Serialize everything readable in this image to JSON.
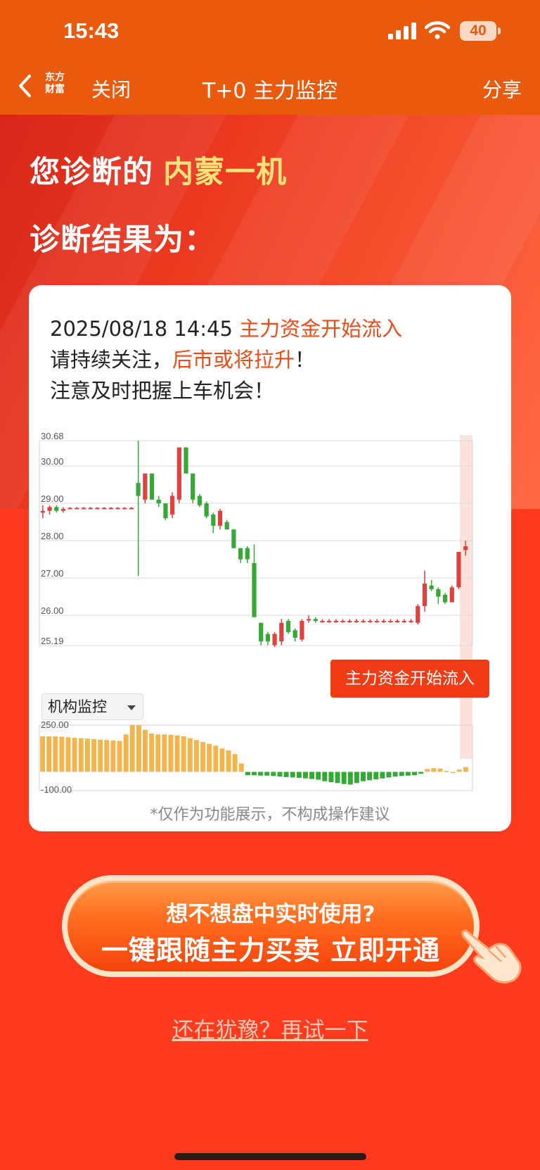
{
  "status_bar": {
    "time": "15:43",
    "battery": "40"
  },
  "nav": {
    "logo_line1": "东方",
    "logo_line2": "财富",
    "close": "关闭",
    "title": "T+0 主力监控",
    "share": "分享"
  },
  "hero": {
    "prefix": "您诊断的",
    "stock_name": "内蒙一机",
    "result_label": "诊断结果为："
  },
  "message": {
    "datetime": "2025/08/18 14:45",
    "signal": "主力资金开始流入",
    "line2_prefix": "请持续关注，",
    "line2_highlight": "后市或将拉升",
    "line2_suffix": "！",
    "line3": "注意及时把握上车机会！"
  },
  "chart_controls": {
    "indicator_select": "机构监控",
    "signal_badge": "主力资金开始流入"
  },
  "disclaimer": "*仅作为功能展示，不构成操作建议",
  "cta": {
    "line1": "想不想盘中实时使用?",
    "line2": "一键跟随主力买卖 立即开通"
  },
  "retry": "还在犹豫？再试一下",
  "colors": {
    "up": "#e04040",
    "down": "#36a836",
    "flow_in": "#f2b54c",
    "flow_out": "#36a836",
    "accent": "#f24a16"
  },
  "chart_data": [
    {
      "type": "candlestick",
      "ytick_labels": [
        "30.68",
        "30.00",
        "29.00",
        "28.00",
        "27.00",
        "26.00",
        "25.19"
      ],
      "ylim": [
        25.19,
        30.68
      ],
      "grid": true,
      "annotation": "主力资金开始流入",
      "series": [
        {
          "o": 28.75,
          "h": 28.95,
          "l": 28.6,
          "c": 28.8
        },
        {
          "o": 28.8,
          "h": 28.95,
          "l": 28.7,
          "c": 28.9
        },
        {
          "o": 28.9,
          "h": 28.95,
          "l": 28.75,
          "c": 28.8
        },
        {
          "o": 28.8,
          "h": 28.9,
          "l": 28.75,
          "c": 28.85
        },
        {
          "o": 28.88,
          "h": 28.9,
          "l": 28.86,
          "c": 28.88
        },
        {
          "o": 28.88,
          "h": 28.9,
          "l": 28.86,
          "c": 28.88
        },
        {
          "o": 28.88,
          "h": 28.9,
          "l": 28.86,
          "c": 28.88
        },
        {
          "o": 28.88,
          "h": 28.9,
          "l": 28.86,
          "c": 28.88
        },
        {
          "o": 28.88,
          "h": 28.9,
          "l": 28.86,
          "c": 28.88
        },
        {
          "o": 28.88,
          "h": 28.9,
          "l": 28.86,
          "c": 28.88
        },
        {
          "o": 28.88,
          "h": 28.9,
          "l": 28.86,
          "c": 28.88
        },
        {
          "o": 28.88,
          "h": 28.9,
          "l": 28.86,
          "c": 28.88
        },
        {
          "o": 28.88,
          "h": 28.9,
          "l": 28.86,
          "c": 28.88
        },
        {
          "o": 28.88,
          "h": 28.9,
          "l": 28.86,
          "c": 28.88
        },
        {
          "o": 29.55,
          "h": 30.68,
          "l": 27.05,
          "c": 29.2
        },
        {
          "o": 29.1,
          "h": 29.8,
          "l": 29.0,
          "c": 29.8
        },
        {
          "o": 29.8,
          "h": 29.8,
          "l": 29.1,
          "c": 29.1
        },
        {
          "o": 29.1,
          "h": 29.2,
          "l": 28.9,
          "c": 29.0
        },
        {
          "o": 29.0,
          "h": 29.0,
          "l": 28.55,
          "c": 28.6
        },
        {
          "o": 28.7,
          "h": 29.3,
          "l": 28.6,
          "c": 29.2
        },
        {
          "o": 29.1,
          "h": 30.5,
          "l": 29.0,
          "c": 30.5
        },
        {
          "o": 30.5,
          "h": 30.5,
          "l": 29.8,
          "c": 29.8
        },
        {
          "o": 29.8,
          "h": 29.8,
          "l": 29.0,
          "c": 29.1
        },
        {
          "o": 29.2,
          "h": 29.25,
          "l": 28.9,
          "c": 28.95
        },
        {
          "o": 29.0,
          "h": 29.05,
          "l": 28.6,
          "c": 28.65
        },
        {
          "o": 28.7,
          "h": 28.75,
          "l": 28.2,
          "c": 28.4
        },
        {
          "o": 28.4,
          "h": 28.85,
          "l": 28.3,
          "c": 28.8
        },
        {
          "o": 28.5,
          "h": 28.55,
          "l": 28.3,
          "c": 28.3
        },
        {
          "o": 28.3,
          "h": 28.3,
          "l": 27.8,
          "c": 27.8
        },
        {
          "o": 27.8,
          "h": 27.8,
          "l": 27.4,
          "c": 27.5
        },
        {
          "o": 27.8,
          "h": 27.85,
          "l": 27.4,
          "c": 27.5
        },
        {
          "o": 27.4,
          "h": 27.9,
          "l": 26.0,
          "c": 25.95
        },
        {
          "o": 25.8,
          "h": 25.8,
          "l": 25.2,
          "c": 25.3
        },
        {
          "o": 25.5,
          "h": 25.55,
          "l": 25.2,
          "c": 25.3
        },
        {
          "o": 25.2,
          "h": 25.55,
          "l": 25.15,
          "c": 25.5
        },
        {
          "o": 25.3,
          "h": 25.9,
          "l": 25.2,
          "c": 25.8
        },
        {
          "o": 25.85,
          "h": 25.9,
          "l": 25.5,
          "c": 25.55
        },
        {
          "o": 25.6,
          "h": 25.65,
          "l": 25.3,
          "c": 25.4
        },
        {
          "o": 25.35,
          "h": 25.9,
          "l": 25.3,
          "c": 25.85
        },
        {
          "o": 25.9,
          "h": 26.0,
          "l": 25.8,
          "c": 25.9
        },
        {
          "o": 25.9,
          "h": 25.95,
          "l": 25.8,
          "c": 25.85
        },
        {
          "o": 25.85,
          "h": 25.9,
          "l": 25.8,
          "c": 25.85
        },
        {
          "o": 25.85,
          "h": 25.9,
          "l": 25.8,
          "c": 25.85
        },
        {
          "o": 25.85,
          "h": 25.9,
          "l": 25.8,
          "c": 25.85
        },
        {
          "o": 25.85,
          "h": 25.9,
          "l": 25.8,
          "c": 25.85
        },
        {
          "o": 25.85,
          "h": 25.9,
          "l": 25.8,
          "c": 25.85
        },
        {
          "o": 25.85,
          "h": 25.9,
          "l": 25.8,
          "c": 25.85
        },
        {
          "o": 25.85,
          "h": 25.9,
          "l": 25.8,
          "c": 25.85
        },
        {
          "o": 25.85,
          "h": 25.9,
          "l": 25.8,
          "c": 25.85
        },
        {
          "o": 25.85,
          "h": 25.9,
          "l": 25.8,
          "c": 25.85
        },
        {
          "o": 25.85,
          "h": 25.9,
          "l": 25.8,
          "c": 25.85
        },
        {
          "o": 25.85,
          "h": 25.9,
          "l": 25.8,
          "c": 25.85
        },
        {
          "o": 25.85,
          "h": 25.9,
          "l": 25.8,
          "c": 25.85
        },
        {
          "o": 25.85,
          "h": 25.9,
          "l": 25.8,
          "c": 25.85
        },
        {
          "o": 25.85,
          "h": 25.9,
          "l": 25.8,
          "c": 25.85
        },
        {
          "o": 25.8,
          "h": 26.3,
          "l": 25.75,
          "c": 26.25
        },
        {
          "o": 26.25,
          "h": 27.2,
          "l": 26.1,
          "c": 26.85
        },
        {
          "o": 26.8,
          "h": 26.95,
          "l": 26.65,
          "c": 26.7
        },
        {
          "o": 26.7,
          "h": 26.75,
          "l": 26.3,
          "c": 26.5
        },
        {
          "o": 26.55,
          "h": 26.6,
          "l": 26.3,
          "c": 26.35
        },
        {
          "o": 26.35,
          "h": 26.8,
          "l": 26.35,
          "c": 26.75
        },
        {
          "o": 26.75,
          "h": 27.7,
          "l": 26.7,
          "c": 27.7
        },
        {
          "o": 27.75,
          "h": 28.0,
          "l": 27.6,
          "c": 27.85
        }
      ]
    },
    {
      "type": "bar",
      "title": "机构监控",
      "ytick_labels": [
        "250.00",
        "-100.00"
      ],
      "ylim": [
        -100,
        250
      ],
      "values": [
        190,
        190,
        190,
        188,
        185,
        182,
        180,
        178,
        175,
        172,
        170,
        168,
        165,
        200,
        250,
        250,
        225,
        205,
        200,
        200,
        198,
        195,
        190,
        180,
        170,
        160,
        150,
        140,
        125,
        115,
        95,
        45,
        -18,
        -18,
        -20,
        -20,
        -22,
        -25,
        -28,
        -30,
        -32,
        -35,
        -38,
        -42,
        -50,
        -55,
        -60,
        -65,
        -68,
        -60,
        -50,
        -45,
        -40,
        -35,
        -30,
        -25,
        -22,
        -20,
        -18,
        -10,
        15,
        20,
        18,
        5,
        0,
        12,
        25
      ]
    }
  ]
}
